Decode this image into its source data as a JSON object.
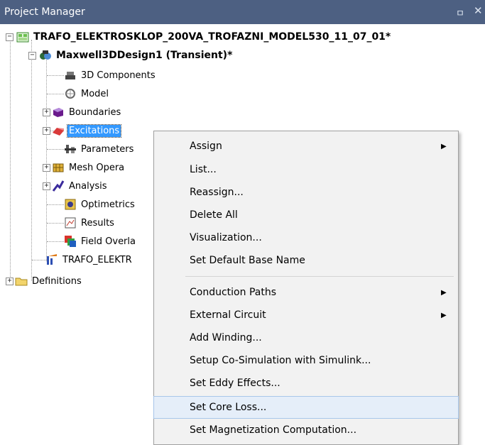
{
  "panel": {
    "title": "Project Manager",
    "pin_icon": "pin-icon",
    "close_icon": "close-icon"
  },
  "tree": {
    "project": "TRAFO_ELEKTROSKLOP_200VA_TROFAZNI_MODEL530_11_07_01*",
    "design": "Maxwell3DDesign1 (Transient)*",
    "items": [
      "3D Components",
      "Model",
      "Boundaries",
      "Excitations",
      "Parameters",
      "Mesh Opera",
      "Analysis",
      "Optimetrics",
      "Results",
      "Field Overla"
    ],
    "second_design": "TRAFO_ELEKTR",
    "definitions": "Definitions"
  },
  "context_menu": {
    "group1": [
      "Assign",
      "List...",
      "Reassign...",
      "Delete All",
      "Visualization...",
      "Set Default Base Name"
    ],
    "group2": [
      "Conduction Paths",
      "External Circuit",
      "Add Winding...",
      "Setup Co-Simulation with Simulink...",
      "Set Eddy Effects...",
      "Set Core Loss...",
      "Set Magnetization Computation..."
    ],
    "submenu_arrow": "▶"
  },
  "colors": {
    "titlebar": "#4d6082",
    "selection": "#3399ff",
    "menu_bg": "#f2f2f2",
    "hover": "#e5eef9"
  }
}
